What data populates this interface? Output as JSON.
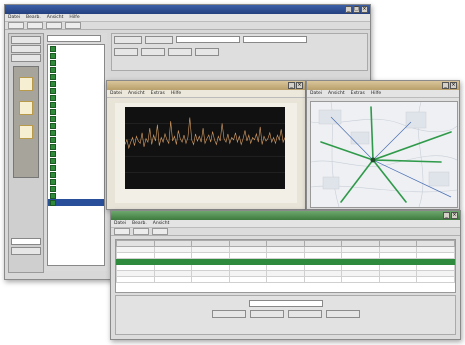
{
  "main_window": {
    "menu": [
      "Datei",
      "Bearb.",
      "Ansicht",
      "Hilfe"
    ],
    "left_tabs": [
      "",
      "",
      ""
    ],
    "list_items": [
      "",
      "",
      "",
      "",
      "",
      "",
      "",
      "",
      "",
      "",
      "",
      "",
      "",
      "",
      "",
      "",
      "",
      "",
      "",
      "",
      "",
      "",
      ""
    ],
    "toolbar_buttons": [
      "",
      "",
      "",
      ""
    ],
    "grid_buttons": [
      "",
      "",
      "",
      "",
      "",
      ""
    ]
  },
  "chart_window": {
    "menu": [
      "Datei",
      "Ansicht",
      "Extras",
      "Hilfe"
    ],
    "chart_data": {
      "type": "line",
      "title": "",
      "xlabel": "",
      "ylabel": "",
      "x_ticks": [
        "",
        "",
        "",
        "",
        "",
        "",
        "",
        ""
      ],
      "series": [
        {
          "color": "#d9a066",
          "values": [
            38,
            42,
            35,
            40,
            44,
            37,
            45,
            41,
            39,
            48,
            36,
            43,
            40,
            52,
            38,
            46,
            41,
            55,
            37,
            44,
            40,
            47,
            42,
            39,
            58,
            41,
            45,
            38,
            50,
            43,
            40,
            46,
            39,
            44,
            61,
            42,
            38,
            47,
            41,
            45,
            40,
            52,
            39,
            43,
            46,
            40,
            49,
            42,
            38,
            45,
            41,
            56,
            43,
            40,
            47,
            39,
            44,
            42,
            48,
            40,
            45,
            38,
            43,
            50,
            41,
            46,
            39,
            44,
            42,
            47,
            40,
            53,
            38,
            45,
            41,
            43,
            48,
            40,
            44,
            39,
            46,
            42,
            51,
            40,
            44
          ]
        }
      ],
      "grid": true
    }
  },
  "map_window": {
    "menu": [
      "Datei",
      "Ansicht",
      "Extras",
      "Hilfe"
    ]
  },
  "table_window": {
    "menu": [
      "Datei",
      "Bearb.",
      "Ansicht"
    ],
    "columns": [
      "",
      "",
      "",
      "",
      "",
      "",
      "",
      "",
      ""
    ],
    "rows": [
      [
        "",
        "",
        "",
        "",
        "",
        "",
        "",
        "",
        ""
      ],
      [
        "",
        "",
        "",
        "",
        "",
        "",
        "",
        "",
        ""
      ],
      [
        "",
        "",
        "",
        "",
        "",
        "",
        "",
        "",
        ""
      ],
      [
        "",
        "",
        "",
        "",
        "",
        "",
        "",
        "",
        ""
      ],
      [
        "",
        "",
        "",
        "",
        "",
        "",
        "",
        "",
        ""
      ],
      [
        "",
        "",
        "",
        "",
        "",
        "",
        "",
        "",
        ""
      ]
    ],
    "highlight_row": 2,
    "footer_buttons": [
      "",
      "",
      "",
      ""
    ]
  }
}
